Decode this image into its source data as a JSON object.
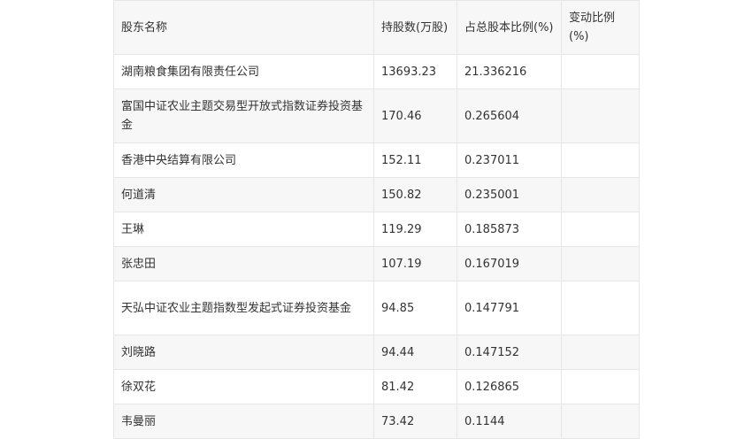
{
  "table": {
    "headers": [
      "股东名称",
      "持股数(万股)",
      "占总股本比例(%)",
      "变动比例(%)"
    ],
    "rows": [
      [
        "湖南粮食集团有限责任公司",
        "13693.23",
        "21.336216",
        ""
      ],
      [
        "富国中证农业主题交易型开放式指数证券投资基金",
        "170.46",
        "0.265604",
        ""
      ],
      [
        "香港中央结算有限公司",
        "152.11",
        "0.237011",
        ""
      ],
      [
        "何道清",
        "150.82",
        "0.235001",
        ""
      ],
      [
        "王琳",
        "119.29",
        "0.185873",
        ""
      ],
      [
        "张忠田",
        "107.19",
        "0.167019",
        ""
      ],
      [
        "天弘中证农业主题指数型发起式证券投资基金",
        "94.85",
        "0.147791",
        ""
      ],
      [
        "刘晓路",
        "94.44",
        "0.147152",
        ""
      ],
      [
        "徐双花",
        "81.42",
        "0.126865",
        ""
      ],
      [
        "韦曼丽",
        "73.42",
        "0.1144",
        ""
      ]
    ]
  }
}
